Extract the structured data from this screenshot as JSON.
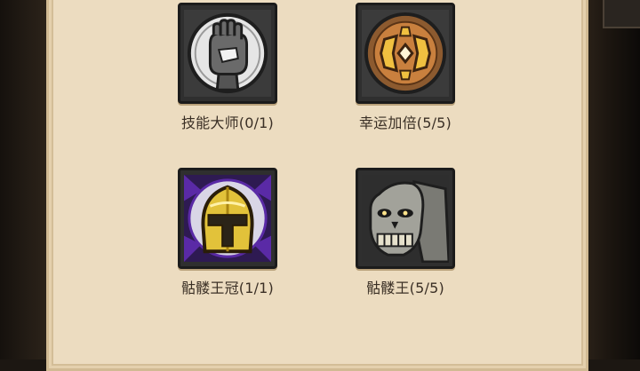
{
  "items": [
    {
      "label": "技能大师(0/1)",
      "icon": "fist-icon"
    },
    {
      "label": "幸运加倍(5/5)",
      "icon": "lucky-shield-icon"
    },
    {
      "label": "骷髅王冠(1/1)",
      "icon": "golden-helmet-icon"
    },
    {
      "label": "骷髅王(5/5)",
      "icon": "skeleton-king-icon"
    }
  ],
  "colors": {
    "panel": "#ecdcc0",
    "frame": "#2f2f2f",
    "text": "#3a2f25",
    "gold": "#e2c23a",
    "purple": "#5a2aa6"
  }
}
